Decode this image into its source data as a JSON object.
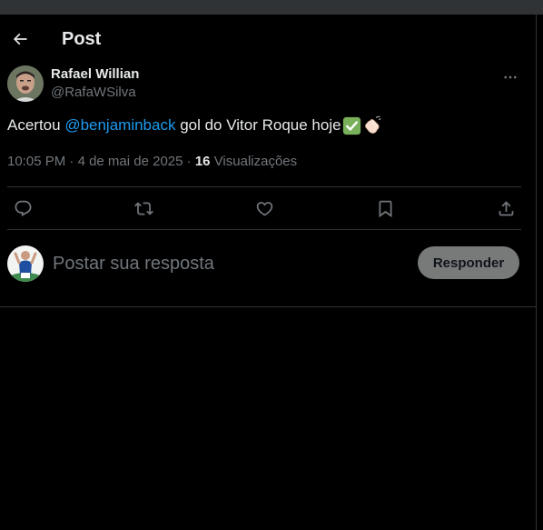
{
  "header": {
    "title": "Post",
    "back_icon": "arrow-left-icon"
  },
  "author": {
    "display_name": "Rafael Willian",
    "handle": "@RafaWSilva",
    "more_icon": "more-horizontal-icon"
  },
  "tweet": {
    "text_before": "Acertou ",
    "mention": "@benjaminback",
    "text_after": " gol do Vitor Roque hoje",
    "emojis": [
      "check-mark-button-emoji",
      "clapping-hands-emoji"
    ]
  },
  "meta": {
    "time": "10:05 PM",
    "date": "4 de mai de 2025",
    "views_count": "16",
    "views_label": "Visualizações"
  },
  "actions": [
    {
      "name": "reply",
      "icon": "reply-icon"
    },
    {
      "name": "repost",
      "icon": "repost-icon"
    },
    {
      "name": "like",
      "icon": "heart-icon"
    },
    {
      "name": "bookmark",
      "icon": "bookmark-icon"
    },
    {
      "name": "share",
      "icon": "share-icon"
    }
  ],
  "reply": {
    "placeholder": "Postar sua resposta",
    "button_label": "Responder"
  },
  "colors": {
    "background": "#000000",
    "text": "#e7e9ea",
    "muted": "#71767b",
    "accent": "#1d9bf0",
    "border": "#2f3336",
    "button_disabled": "#787a7a"
  }
}
